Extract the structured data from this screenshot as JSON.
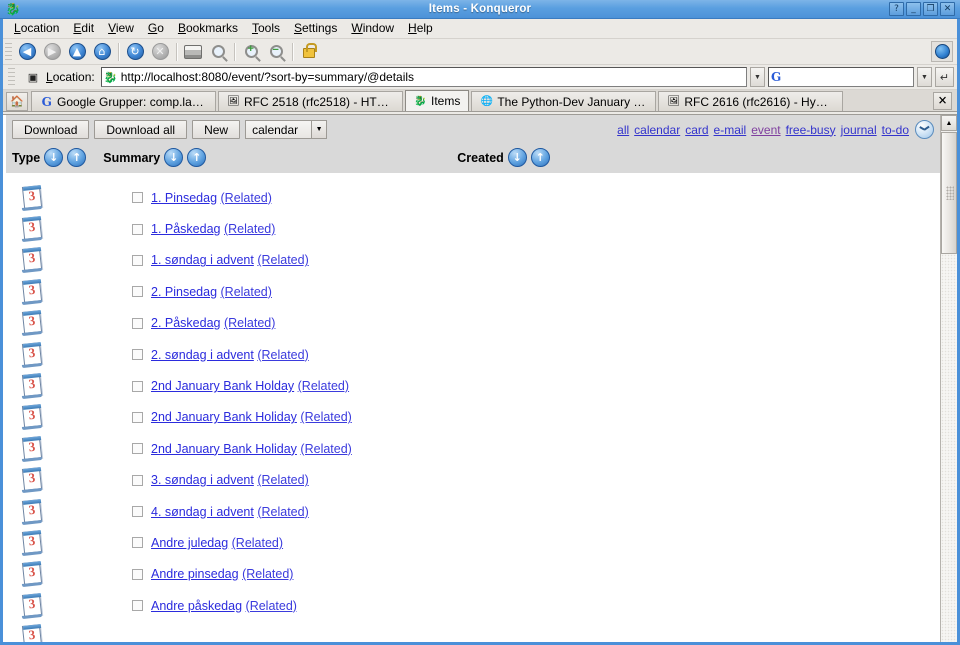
{
  "window": {
    "title": "Items - Konqueror",
    "icon": "konqueror-icon",
    "buttons": {
      "help": "?",
      "minimize": "_",
      "restore": "❐",
      "close": "✕"
    }
  },
  "menubar": [
    {
      "label": "Location",
      "accel": "L"
    },
    {
      "label": "Edit",
      "accel": "E"
    },
    {
      "label": "View",
      "accel": "V"
    },
    {
      "label": "Go",
      "accel": "G"
    },
    {
      "label": "Bookmarks",
      "accel": "B"
    },
    {
      "label": "Tools",
      "accel": "T"
    },
    {
      "label": "Settings",
      "accel": "S"
    },
    {
      "label": "Window",
      "accel": "W"
    },
    {
      "label": "Help",
      "accel": "H"
    }
  ],
  "toolbar": {
    "items": [
      {
        "name": "back-icon",
        "glyph": "◀",
        "enabled": true
      },
      {
        "name": "forward-icon",
        "glyph": "▶",
        "enabled": false
      },
      {
        "name": "up-icon",
        "glyph": "▲",
        "enabled": true
      },
      {
        "name": "home-icon",
        "glyph": "⌂",
        "enabled": true
      },
      {
        "name": "reload-icon",
        "glyph": "↻",
        "enabled": true
      },
      {
        "name": "stop-icon",
        "glyph": "✕",
        "enabled": false
      }
    ],
    "print_icon": "print-icon",
    "find_icon": "find-icon",
    "zoom_in_icon": "zoom-in-icon",
    "zoom_out_icon": "zoom-out-icon",
    "lock_icon": "padlock-icon",
    "konqueror_icon": "konqueror-gear-icon"
  },
  "location": {
    "label": "Location:",
    "label_accel": "o",
    "url": "http://localhost:8080/event/?sort-by=summary/@details",
    "favicon": "konqueror-favicon",
    "search_placeholder": "",
    "search_value": "",
    "search_provider": "Google",
    "go_glyph": "↵"
  },
  "tabs": {
    "home_glyph": "⌂",
    "items": [
      {
        "label": "Google Grupper: comp.lang....",
        "icon": "google-favicon",
        "active": false
      },
      {
        "label": "RFC 2518 (rfc2518) - HTTP ...",
        "icon": "document-favicon",
        "active": false
      },
      {
        "label": "Items",
        "icon": "konqueror-favicon",
        "active": true
      },
      {
        "label": "The Python-Dev January 200...",
        "icon": "globe-favicon",
        "active": false
      },
      {
        "label": "RFC 2616 (rfc2616) - Hyper...",
        "icon": "document-favicon",
        "active": false
      }
    ],
    "close_glyph": "✕"
  },
  "app_toolbar": {
    "download_label": "Download",
    "download_all_label": "Download all",
    "new_label": "New",
    "type_select_value": "calendar",
    "type_select_options": [
      "calendar",
      "card",
      "e-mail",
      "event",
      "free-busy",
      "journal",
      "to-do"
    ],
    "arrow_glyph": "▼"
  },
  "quick_links": [
    {
      "label": "all",
      "visited": false
    },
    {
      "label": "calendar",
      "visited": false
    },
    {
      "label": "card",
      "visited": false
    },
    {
      "label": "e-mail",
      "visited": false
    },
    {
      "label": "event",
      "visited": true
    },
    {
      "label": "free-busy",
      "visited": false
    },
    {
      "label": "journal",
      "visited": false
    },
    {
      "label": "to-do",
      "visited": false
    }
  ],
  "clock_icon": "clock-icon",
  "columns": [
    {
      "label": "Type",
      "sort_desc": "↓",
      "sort_asc": "↑"
    },
    {
      "label": "Summary",
      "sort_desc": "↓",
      "sort_asc": "↑"
    },
    {
      "label": "Created",
      "sort_desc": "↓",
      "sort_asc": "↑"
    }
  ],
  "related_label": "(Related)",
  "row_icon": {
    "name": "calendar-page-icon",
    "number": "3"
  },
  "rows": [
    {
      "summary": "1. Pinsedag"
    },
    {
      "summary": "1. Påskedag"
    },
    {
      "summary": "1. søndag i advent"
    },
    {
      "summary": "2. Pinsedag"
    },
    {
      "summary": "2. Påskedag"
    },
    {
      "summary": "2. søndag i advent"
    },
    {
      "summary": "2nd January Bank Holday"
    },
    {
      "summary": "2nd January Bank Holiday"
    },
    {
      "summary": "2nd January Bank Holiday"
    },
    {
      "summary": "3. søndag i advent"
    },
    {
      "summary": "4. søndag i advent"
    },
    {
      "summary": "Andre juledag"
    },
    {
      "summary": "Andre pinsedag"
    },
    {
      "summary": "Andre påskedag"
    },
    {
      "summary": ""
    }
  ],
  "scrollbar": {
    "up_glyph": "▲",
    "down_glyph": "▼"
  },
  "colors": {
    "titlebar": "#4a90d9",
    "link": "#2b2bdd",
    "visited_link": "#7f3f9f",
    "toolbar_bg": "#eceae6",
    "header_bg": "#d9d9d9",
    "icon_number": "#d9544a"
  }
}
